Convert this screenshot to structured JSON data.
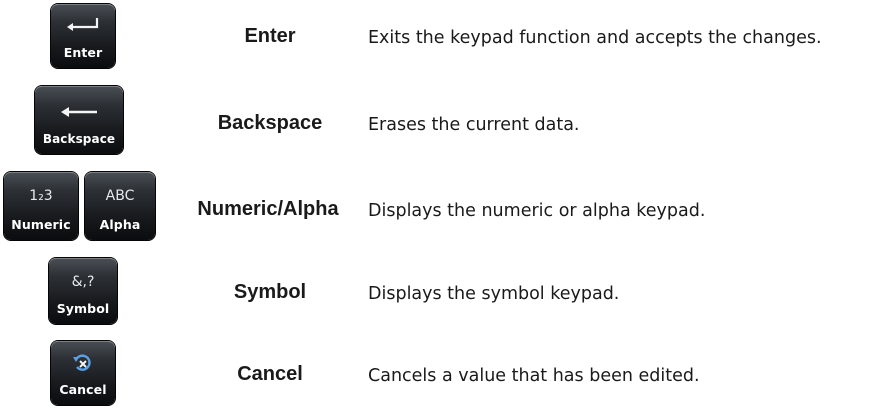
{
  "rows": [
    {
      "key_label": "Enter",
      "key_icon": "enter-arrow-icon",
      "name": "Enter",
      "description": "Exits the keypad function and accepts the changes."
    },
    {
      "key_label": "Backspace",
      "key_icon": "left-arrow-icon",
      "name": "Backspace",
      "description": "Erases the current data."
    },
    {
      "key_label": "Numeric",
      "key_glyph": "1₂3",
      "key_label_2": "Alpha",
      "key_glyph_2": "ABC",
      "name": "Numeric/Alpha",
      "description": "Displays the numeric or alpha keypad."
    },
    {
      "key_label": "Symbol",
      "key_glyph": "&,?",
      "name": "Symbol",
      "description": "Displays the symbol keypad."
    },
    {
      "key_label": "Cancel",
      "key_icon": "cancel-undo-icon",
      "name": "Cancel",
      "description": "Cancels a value that has been edited."
    }
  ],
  "colors": {
    "key_bg": "#16181b",
    "key_text": "#ffffff",
    "text": "#1a1a1a",
    "cancel_icon": "#4a90d9"
  }
}
